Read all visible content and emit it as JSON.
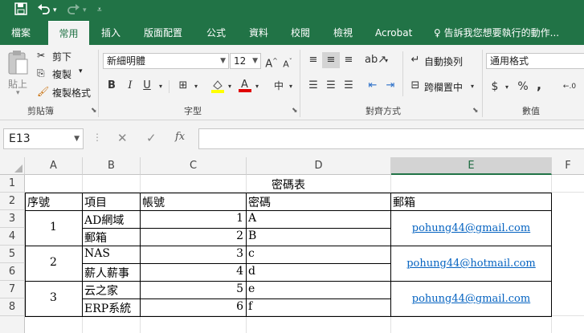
{
  "qat": {
    "save_icon": "save-icon",
    "undo_icon": "undo-icon",
    "redo_icon": "redo-icon",
    "customize_icon": "customize-qat-icon"
  },
  "tabs": [
    "檔案",
    "常用",
    "插入",
    "版面配置",
    "公式",
    "資料",
    "校閱",
    "檢視",
    "Acrobat"
  ],
  "active_tab": "常用",
  "tell_me": "告訴我您想要執行的動作...",
  "clipboard": {
    "paste": "貼上",
    "cut": "剪下",
    "copy": "複製",
    "format_painter": "複製格式",
    "label": "剪貼簿"
  },
  "font": {
    "name": "新細明體",
    "size": "12",
    "bold": "B",
    "italic": "I",
    "underline": "U",
    "label": "字型"
  },
  "alignment": {
    "wrap_text": "自動換列",
    "merge_center": "跨欄置中",
    "label": "對齊方式"
  },
  "number": {
    "format": "通用格式",
    "currency": "$",
    "percent": "%",
    "comma": ",",
    "label": "數值"
  },
  "formula_bar": {
    "name_box": "E13",
    "fx": "fx",
    "value": ""
  },
  "columns": [
    "A",
    "B",
    "C",
    "D",
    "E",
    "F"
  ],
  "selected_column": "E",
  "rows": [
    "1",
    "2",
    "3",
    "4",
    "5",
    "6",
    "7",
    "8"
  ],
  "sheet": {
    "title": "密碼表",
    "headers": {
      "a": "序號",
      "b": "項目",
      "c": "帳號",
      "d": "密碼",
      "e": "郵箱"
    },
    "groups": [
      {
        "no": "1",
        "email": "pohung44@gmail.com"
      },
      {
        "no": "2",
        "email": "pohung44@hotmail.com"
      },
      {
        "no": "3",
        "email": "pohung44@gmail.com"
      }
    ],
    "items": [
      {
        "b": "AD網域",
        "c": "1",
        "d": "A"
      },
      {
        "b": "郵箱",
        "c": "2",
        "d": "B"
      },
      {
        "b": "NAS",
        "c": "3",
        "d": "c"
      },
      {
        "b": "薪人薪事",
        "c": "4",
        "d": "d"
      },
      {
        "b": "云之家",
        "c": "5",
        "d": "e"
      },
      {
        "b": "ERP系統",
        "c": "6",
        "d": "f"
      }
    ]
  }
}
